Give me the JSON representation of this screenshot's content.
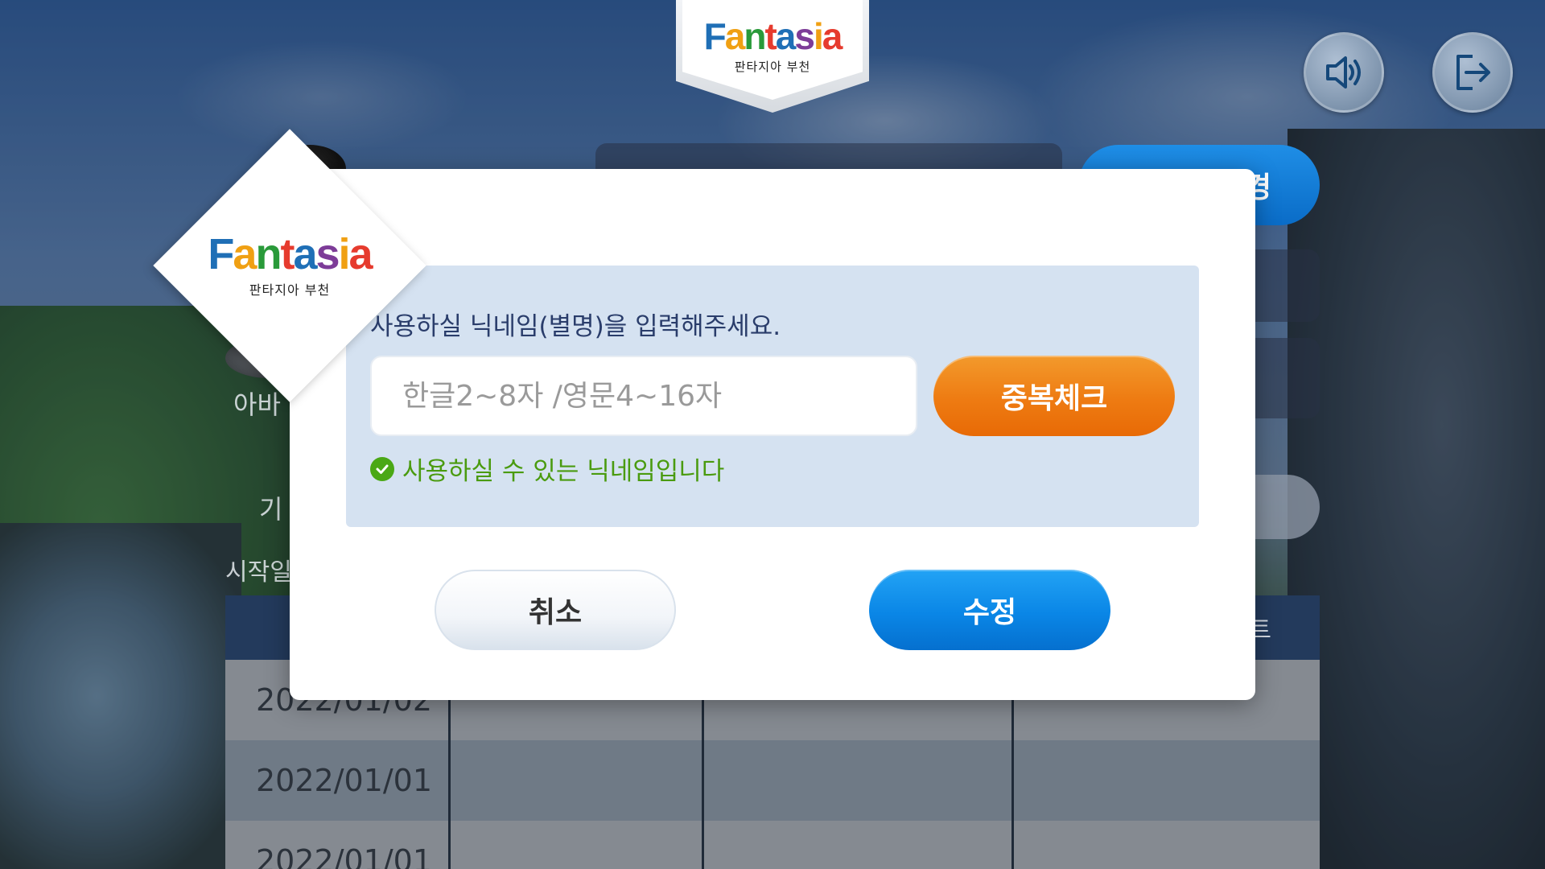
{
  "header": {
    "logo_word": "Fantasia",
    "logo_sub": "판타지아 부천"
  },
  "top_buttons": {
    "sound_icon": "speaker-volume-icon",
    "exit_icon": "logout-icon"
  },
  "background": {
    "button_partial": "경",
    "avatar_label_partial": "아바",
    "label_partial_1": "기",
    "label_partial_2": "시작일",
    "table_header_partial": "트",
    "rows": [
      {
        "date": "2022/01/02"
      },
      {
        "date": "2022/01/01"
      },
      {
        "date": "2022/01/01"
      }
    ]
  },
  "modal": {
    "badge_logo_word": "Fantasia",
    "badge_logo_sub": "판타지아 부천",
    "prompt": "사용하실 닉네임(별명)을 입력해주세요.",
    "nickname_value": "",
    "nickname_placeholder": "한글2~8자 /영문4~16자",
    "check_button": "중복체크",
    "status_message": "사용하실 수 있는 닉네임입니다",
    "status_icon": "check-circle-icon",
    "cancel_button": "취소",
    "save_button": "수정"
  },
  "colors": {
    "accent_orange": "#ee7b12",
    "accent_blue": "#0a86e6",
    "status_green": "#4a9b0f",
    "panel_bg": "#d5e2f1"
  }
}
